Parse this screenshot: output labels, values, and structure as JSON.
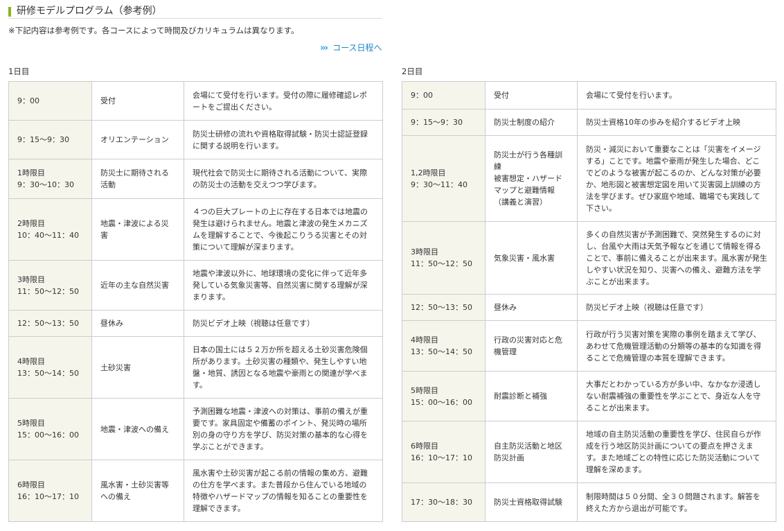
{
  "header": {
    "title": "研修モデルプログラム（参考例）",
    "note": "※下記内容は参考例です。各コースによって時間及びカリキュラムは異なります。",
    "schedule_link": "コース日程へ",
    "accent_color": "#8cb516",
    "link_color": "#1f84c8"
  },
  "day1": {
    "label": "1日目",
    "rows": [
      {
        "time": "9：00",
        "subject": "受付",
        "desc": "会場にて受付を行います。受付の際に履修確認レポートをご提出ください。"
      },
      {
        "time": "9：15～9：30",
        "subject": "オリエンテーション",
        "desc": "防災士研修の流れや資格取得試験・防災士認証登録に関する説明を行います。"
      },
      {
        "time": "1時限目\n9：30～10：30",
        "subject": "防災士に期待される活動",
        "desc": "現代社会で防災士に期待される活動について、実際の防災士の活動を交えつつ学びます。"
      },
      {
        "time": "2時限目\n10：40～11：40",
        "subject": "地震・津波による災害",
        "desc": "４つの巨大プレートの上に存在する日本では地震の発生は避けられません。地震と津波の発生メカニズムを理解することで、今後起こりうる災害とその対策について理解が深まります。"
      },
      {
        "time": "3時限目\n11：50～12：50",
        "subject": "近年の主な自然災害",
        "desc": "地震や津波以外に、地球環境の変化に伴って近年多発している気象災害等、自然災害に関する理解が深まります。"
      },
      {
        "time": "12：50～13：50",
        "subject": "昼休み",
        "desc": "防災ビデオ上映（視聴は任意です）"
      },
      {
        "time": "4時限目\n13：50～14：50",
        "subject": "土砂災害",
        "desc": "日本の国土には５２万か所を超える土砂災害危険個所があります。土砂災害の種類や、発生しやすい地盤・地質、誘因となる地震や豪雨との関連が学べます。"
      },
      {
        "time": "5時限目\n15：00～16：00",
        "subject": "地震・津波への備え",
        "desc": "予測困難な地震・津波への対策は、事前の備えが重要です。家具固定や備蓄のポイント、発災時の場所別の身の守り方を学び、防災対策の基本的な心得を学ぶことができます。"
      },
      {
        "time": "6時限目\n16：10～17：10",
        "subject": "風水害・土砂災害等への備え",
        "desc": "風水害や土砂災害が起こる前の情報の集め方、避難の仕方を学べます。また普段から住んでいる地域の特徴やハザードマップの情報を知ることの重要性を理解できます。"
      }
    ]
  },
  "day2": {
    "label": "2日目",
    "rows": [
      {
        "time": "9：00",
        "subject": "受付",
        "desc": "会場にて受付を行います。"
      },
      {
        "time": "9：15～9：30",
        "subject": "防災士制度の紹介",
        "desc": "防災士資格10年の歩みを紹介するビデオ上映"
      },
      {
        "time": "1,2時限目\n9：30～11：40",
        "subject": "防災士が行う各種訓練\n被害想定・ハザードマップと避難情報\n（講義と演習）",
        "desc": "防災・減災において重要なことは「災害をイメージする」ことです。地震や豪雨が発生した場合、どこでどのような被害が起こるのか、どんな対策が必要か、地形図と被害想定図を用いて災害図上訓練の方法を学びます。ぜひ家庭や地域、職場でも実践して下さい。"
      },
      {
        "time": "3時限目\n11：50～12：50",
        "subject": "気象災害・風水害",
        "desc": "多くの自然災害が予測困難で、突然発生するのに対し、台風や大雨は天気予報などを通じて情報を得ることで、事前に備えることが出来ます。風水害が発生しやすい状況を知り、災害への備え、避難方法を学ぶことが出来ます。"
      },
      {
        "time": "12：50～13：50",
        "subject": "昼休み",
        "desc": "防災ビデオ上映（視聴は任意です）"
      },
      {
        "time": "4時限目\n13：50～14：50",
        "subject": "行政の災害対応と危機管理",
        "desc": "行政が行う災害対策を実際の事例を踏まえて学び、あわせて危機管理活動の分類等の基本的な知識を得ることで危機管理の本質を理解できます。"
      },
      {
        "time": "5時限目\n15：00～16：00",
        "subject": "耐震診断と補強",
        "desc": "大事だとわかっている方が多い中、なかなか浸透しない耐震補強の重要性を学ぶことで、身近な人を守ることが出来ます。"
      },
      {
        "time": "6時限目\n16：10～17：10",
        "subject": "自主防災活動と地区防災計画",
        "desc": "地域の自主防災活動の重要性を学び、住民自らが作成を行う地区防災計画についての要点を押さえます。また地域ごとの特性に応じた防災活動について理解を深めます。"
      },
      {
        "time": "17：30～18：30",
        "subject": "防災士資格取得試験",
        "desc": "制限時間は５０分間、全３０問題されます。解答を終えた方から退出が可能です。"
      }
    ]
  }
}
